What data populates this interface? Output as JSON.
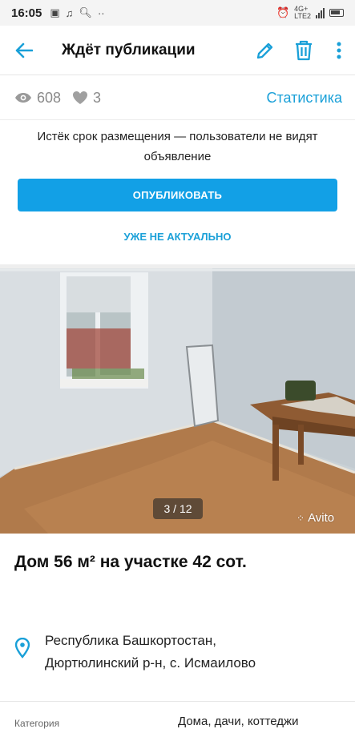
{
  "status_bar": {
    "time": "16:05",
    "network": "4G+",
    "network_sub": "LTE2"
  },
  "app_bar": {
    "title": "Ждёт публикации",
    "icons": [
      "back-arrow-icon",
      "edit-pencil-icon",
      "trash-icon",
      "more-vert-icon"
    ]
  },
  "stats": {
    "views": "608",
    "likes": "3",
    "statistics_link": "Статистика"
  },
  "notice": {
    "text": "Истёк срок размещения — пользователи не видят объявление"
  },
  "actions": {
    "publish_label": "ОПУБЛИКОВАТЬ",
    "inactive_label": "УЖЕ НЕ АКТУАЛЬНО"
  },
  "gallery": {
    "counter": "3 / 12",
    "watermark": "Avito"
  },
  "listing": {
    "title": "Дом 56 м² на участке 42 сот.",
    "address_line1": "Республика Башкортостан,",
    "address_line2": "Дюртюлинский р-н, с. Исмаилово"
  },
  "attributes": [
    {
      "key": "Категория",
      "value": "Дома, дачи, коттеджи"
    }
  ],
  "colors": {
    "accent": "#12a0e6",
    "link": "#1aa0d8",
    "muted": "#8a8a8a"
  }
}
